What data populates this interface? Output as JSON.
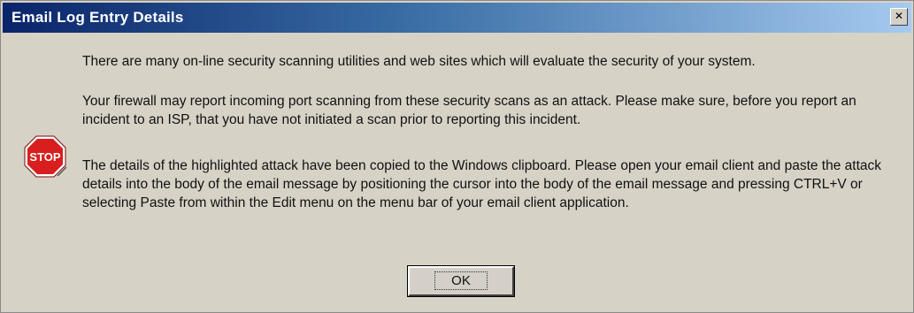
{
  "window": {
    "title": "Email Log Entry Details",
    "close_label": "✕"
  },
  "icon": {
    "name": "stop-icon",
    "label": "STOP",
    "color": "#d81e1e"
  },
  "message": {
    "paragraph_1": "There are many on-line security scanning utilities and web sites which will evaluate the security of your system.",
    "paragraph_2": "Your firewall may report incoming port scanning from these security scans as an attack. Please make sure, before you report an incident to an ISP, that you have not initiated a scan prior to reporting this incident.",
    "paragraph_3": "The details of the highlighted attack have been copied to the Windows clipboard. Please open your email client and paste the attack details into the body of the email message by positioning the cursor into the body of the email message and pressing CTRL+V or selecting Paste from within the Edit menu on the menu bar of your email client application."
  },
  "buttons": {
    "ok_label": "OK"
  }
}
